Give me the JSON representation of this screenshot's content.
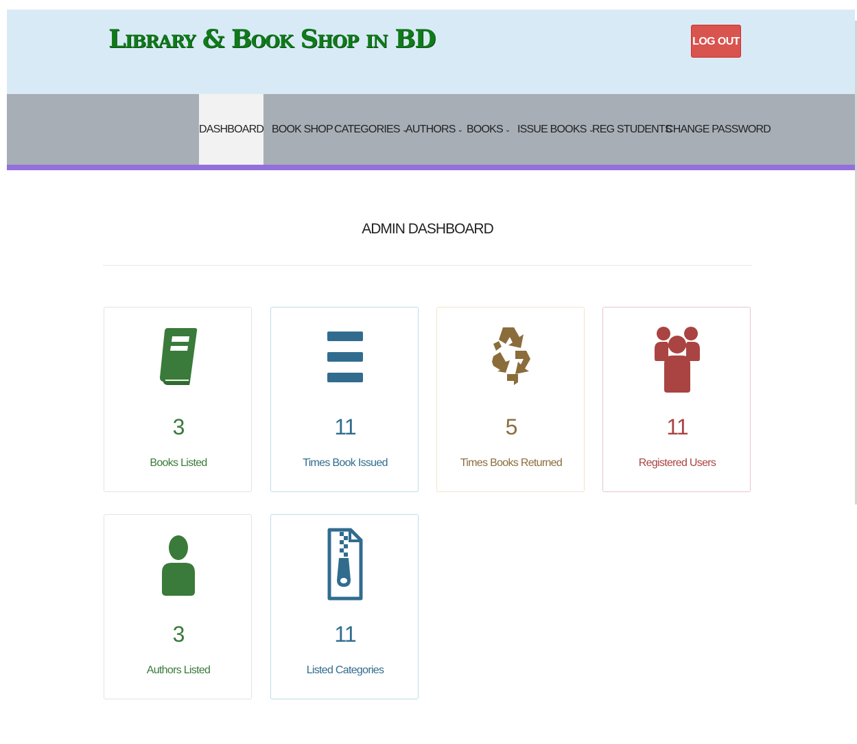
{
  "header": {
    "brand": "Library & Book Shop in BD",
    "logout_label": "LOG OUT"
  },
  "nav": {
    "items": [
      {
        "label": "DASHBOARD",
        "dropdown": false,
        "active": true
      },
      {
        "label": "BOOK SHOP",
        "dropdown": false,
        "active": false
      },
      {
        "label": "CATEGORIES",
        "dropdown": true,
        "active": false
      },
      {
        "label": "AUTHORS",
        "dropdown": true,
        "active": false
      },
      {
        "label": "BOOKS",
        "dropdown": true,
        "active": false
      },
      {
        "label": "ISSUE BOOKS",
        "dropdown": true,
        "active": false
      },
      {
        "label": "REG STUDENTS",
        "dropdown": false,
        "active": false
      },
      {
        "label": "CHANGE PASSWORD",
        "dropdown": false,
        "active": false
      }
    ],
    "caret_glyph": "⌄"
  },
  "main": {
    "title": "ADMIN DASHBOARD",
    "cards": [
      {
        "count": "3",
        "label": "Books Listed",
        "icon": "book-icon",
        "color": "#3a7a3a",
        "border": "#e3e3e3"
      },
      {
        "count": "11",
        "label": "Times Book Issued",
        "icon": "bars-icon",
        "color": "#316c8f",
        "border": "#bcdce9"
      },
      {
        "count": "5",
        "label": "Times Books Returned",
        "icon": "recycle-icon",
        "color": "#8a6d3b",
        "border": "#f1e6cc"
      },
      {
        "count": "11",
        "label": "Registered Users",
        "icon": "users-icon",
        "color": "#a94442",
        "border": "#e8c4cc"
      },
      {
        "count": "3",
        "label": "Authors Listed",
        "icon": "user-icon",
        "color": "#3a7a3a",
        "border": "#e3e3e3"
      },
      {
        "count": "11",
        "label": "Listed Categories",
        "icon": "file-archive-icon",
        "color": "#316c8f",
        "border": "#bcdce9"
      }
    ]
  },
  "colors": {
    "header_bg": "#d9eaf7",
    "navbar_bg": "#a7aeb6",
    "nav_accent": "#9370db",
    "logout_bg": "#d9534f",
    "brand": "#0f7a1a"
  }
}
